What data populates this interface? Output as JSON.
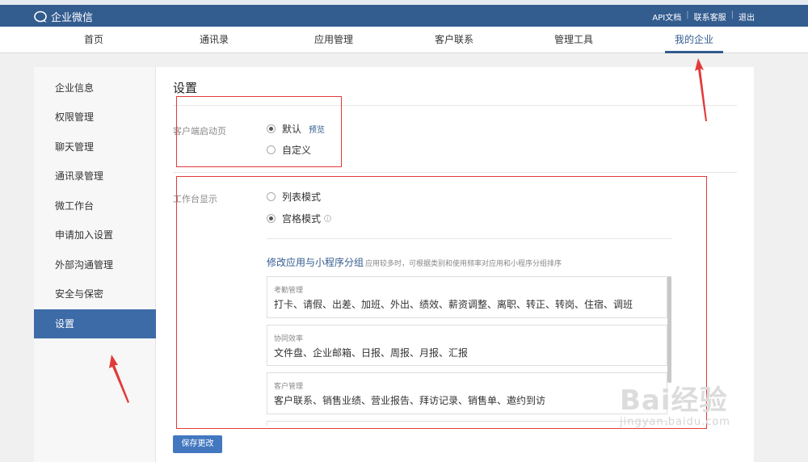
{
  "app": {
    "name": "企业微信",
    "links": [
      "API文档",
      "联系客服",
      "退出"
    ]
  },
  "nav": {
    "items": [
      "首页",
      "通讯录",
      "应用管理",
      "客户联系",
      "管理工具",
      "我的企业"
    ],
    "active_index": 5
  },
  "sidebar": {
    "items": [
      "企业信息",
      "权限管理",
      "聊天管理",
      "通讯录管理",
      "微工作台",
      "申请加入设置",
      "外部沟通管理",
      "安全与保密",
      "设置"
    ],
    "active_index": 8
  },
  "settings": {
    "title": "设置",
    "client_launch": {
      "label": "客户端启动页",
      "options": [
        "默认",
        "自定义"
      ],
      "selected": "默认",
      "preview_link": "预览"
    },
    "workbench": {
      "label": "工作台显示",
      "options": [
        "列表模式",
        "宫格模式"
      ],
      "selected": "宫格模式",
      "group_title": "修改应用与小程序分组",
      "group_hint": "应用较多时，可根据类别和使用频率对应用和小程序分组排序",
      "groups": [
        {
          "title": "考勤管理",
          "apps": "打卡、请假、出差、加班、外出、绩效、薪资调整、离职、转正、转岗、住宿、调班"
        },
        {
          "title": "协同效率",
          "apps": "文件盘、企业邮箱、日报、周报、月报、汇报"
        },
        {
          "title": "客户管理",
          "apps": "客户联系、销售业绩、营业报告、拜访记录、销售单、邀约到访"
        }
      ]
    },
    "save_label": "保存更改"
  },
  "watermark": {
    "brand": "Bai经验",
    "url": "jingyan.baidu.com"
  },
  "colors": {
    "topbar": "#335c8f",
    "sidebar_active": "#3d6ba8",
    "button": "#4378c1",
    "annotation": "#e23a3a"
  }
}
